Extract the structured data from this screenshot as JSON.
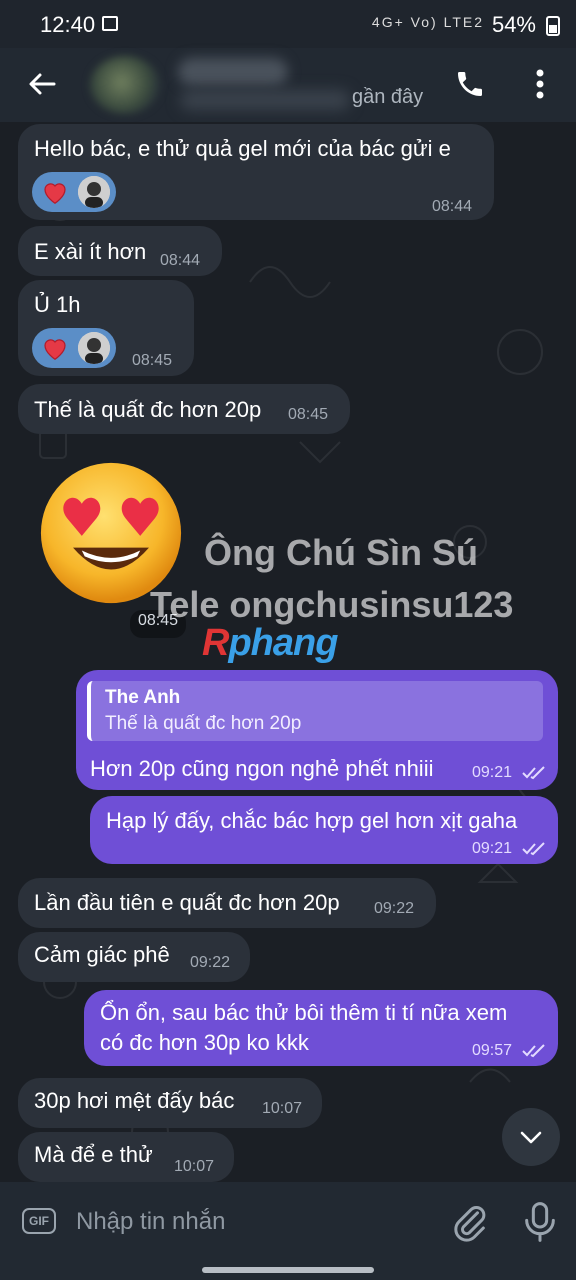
{
  "status_bar": {
    "time": "12:40",
    "network_indicators": "4G+ Vo) LTE2",
    "battery": "54%"
  },
  "header": {
    "contact_status": "gần đây",
    "icons": [
      "back-arrow-icon",
      "phone-icon",
      "more-vert-icon"
    ]
  },
  "messages": [
    {
      "dir": "in",
      "text": "Hello bác, e thử quả gel mới của bác gửi e",
      "time": "08:44",
      "reactions": [
        "heart",
        "avatar"
      ]
    },
    {
      "dir": "in",
      "text": "E xài ít hơn",
      "time": "08:44"
    },
    {
      "dir": "in",
      "text": "Ủ 1h",
      "time": "08:45",
      "reactions": [
        "heart",
        "avatar"
      ]
    },
    {
      "dir": "in",
      "text": "Thế là quất đc hơn 20p",
      "time": "08:45"
    },
    {
      "dir": "in",
      "type": "sticker",
      "sticker": "heart-eyes-emoji",
      "time": "08:45"
    },
    {
      "dir": "out",
      "reply_to_name": "The Anh",
      "reply_to_text": "Thế là quất đc hơn 20p",
      "text": "Hơn 20p cũng ngon nghẻ phết nhiii",
      "time": "09:21",
      "status": "read"
    },
    {
      "dir": "out",
      "text": "Hạp lý đấy, chắc bác hợp gel hơn xịt gaha",
      "time": "09:21",
      "status": "read"
    },
    {
      "dir": "in",
      "text": "Lần đầu tiên e quất đc hơn 20p",
      "time": "09:22"
    },
    {
      "dir": "in",
      "text": "Cảm giác phê",
      "time": "09:22"
    },
    {
      "dir": "out",
      "text_line1": "Ổn ổn, sau bác thử bôi thêm ti tí nữa xem",
      "text_line2": "có đc hơn 30p ko kkk",
      "time": "09:57",
      "status": "read"
    },
    {
      "dir": "in",
      "text": "30p hơi mệt đấy bác",
      "time": "10:07"
    },
    {
      "dir": "in",
      "text": "Mà để e thử",
      "time": "10:07"
    }
  ],
  "watermark": {
    "line1": "Ông Chú Sìn Sú",
    "line2": "Tele ongchusinsu123",
    "logo_r": "R",
    "logo_rest": "phang"
  },
  "composer": {
    "gif_label": "GIF",
    "placeholder": "Nhập tin nhắn"
  },
  "colors": {
    "incoming_bubble": "#2b313a",
    "outgoing_bubble": "#6f4fd6",
    "reaction_chip": "#5b8ec7"
  }
}
